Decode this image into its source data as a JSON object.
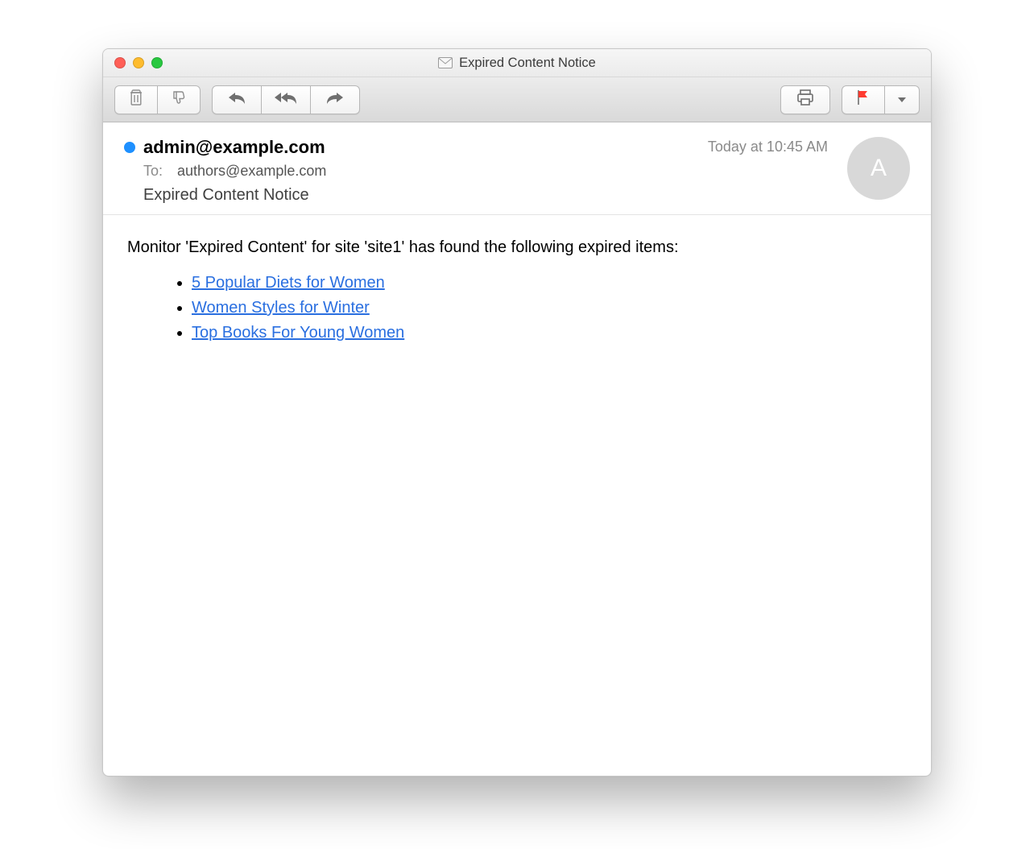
{
  "window": {
    "title": "Expired Content Notice"
  },
  "header": {
    "from": "admin@example.com",
    "to_label": "To:",
    "to": "authors@example.com",
    "timestamp": "Today at 10:45 AM",
    "subject": "Expired Content Notice",
    "avatar_initial": "A"
  },
  "body": {
    "monitor_name": "Expired Content",
    "site_name": "site1",
    "intro": "Monitor 'Expired Content' for site 'site1' has found the following expired items:",
    "links": [
      "5 Popular Diets for Women",
      "Women Styles for Winter",
      "Top Books For Young Women"
    ]
  }
}
